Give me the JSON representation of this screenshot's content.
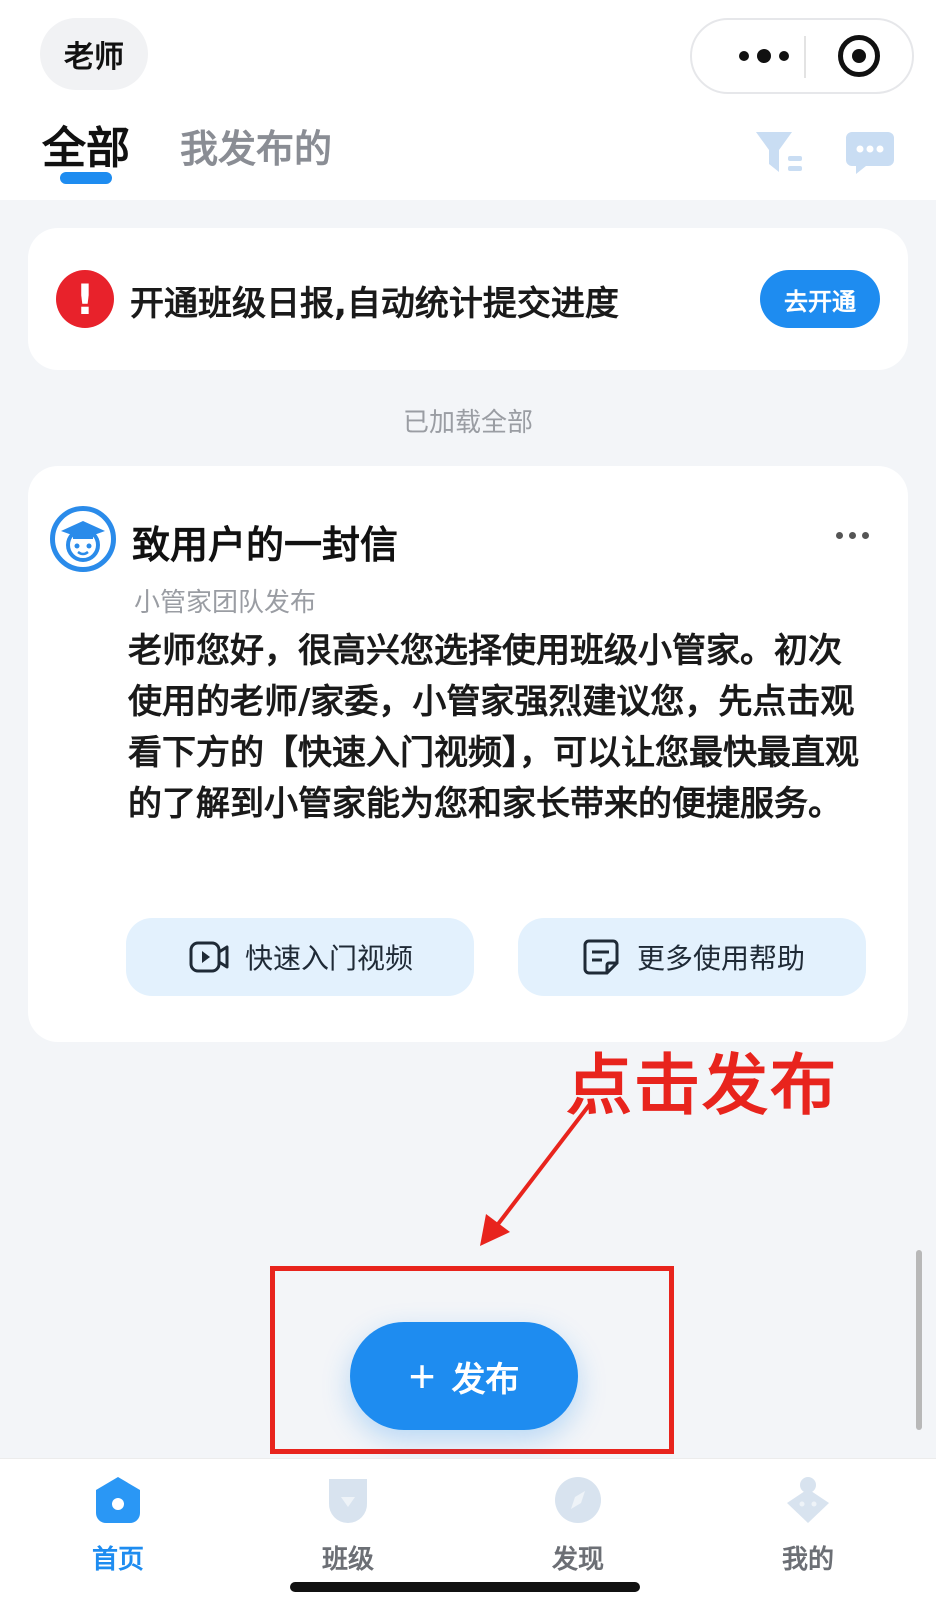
{
  "header": {
    "role": "老师",
    "tabs": [
      {
        "label": "全部",
        "active": true
      },
      {
        "label": "我发布的",
        "active": false
      }
    ],
    "icons": [
      "more-dots-icon",
      "target-icon",
      "filter-icon",
      "message-icon"
    ]
  },
  "notice": {
    "text": "开通班级日报,自动统计提交进度",
    "button": "去开通"
  },
  "status": {
    "loaded_all": "已加载全部"
  },
  "letter": {
    "title": "致用户的一封信",
    "publisher": "小管家团队发布",
    "body": "老师您好，很高兴您选择使用班级小管家。初次使用的老师/家委，小管家强烈建议您，先点击观看下方的【快速入门视频】，可以让您最快最直观的了解到小管家能为您和家长带来的便捷服务。",
    "buttons": {
      "video": "快速入门视频",
      "help": "更多使用帮助"
    }
  },
  "annotation": {
    "text": "点击发布",
    "color": "#e8241d"
  },
  "publish": {
    "plus": "+",
    "label": "发布"
  },
  "nav": {
    "items": [
      {
        "label": "首页",
        "active": true
      },
      {
        "label": "班级",
        "active": false
      },
      {
        "label": "发现",
        "active": false
      },
      {
        "label": "我的",
        "active": false
      }
    ]
  },
  "colors": {
    "accent": "#1e8cf0",
    "alert": "#e8222b",
    "background": "#f3f5f8"
  }
}
